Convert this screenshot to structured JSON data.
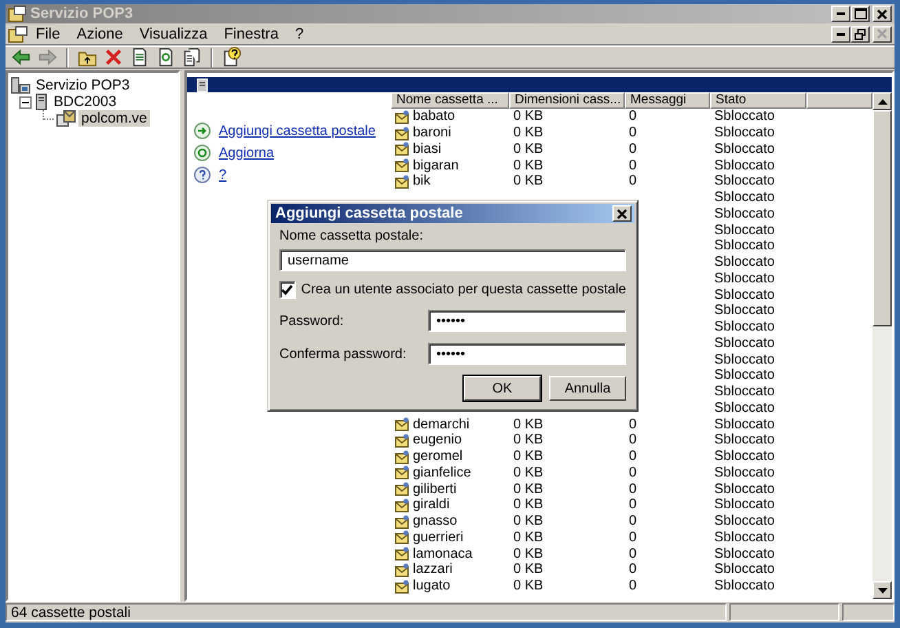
{
  "window": {
    "title": "Servizio POP3",
    "active": false
  },
  "menu": [
    "File",
    "Azione",
    "Visualizza",
    "Finestra",
    "?"
  ],
  "document_controls": {
    "close_disabled": true
  },
  "toolbar": [
    {
      "kind": "back",
      "disabled": false
    },
    {
      "kind": "forward",
      "disabled": true
    },
    {
      "kind": "separator"
    },
    {
      "kind": "up",
      "disabled": false
    },
    {
      "kind": "delete",
      "disabled": false
    },
    {
      "kind": "properties",
      "disabled": false
    },
    {
      "kind": "refresh",
      "disabled": false
    },
    {
      "kind": "export",
      "disabled": false
    },
    {
      "kind": "separator"
    },
    {
      "kind": "help",
      "disabled": false
    }
  ],
  "tree": [
    {
      "label": "Servizio POP3",
      "kind": "service",
      "selected": false,
      "children": [
        {
          "label": "BDC2003",
          "kind": "server",
          "expanded": true,
          "selected": false,
          "children": [
            {
              "label": "polcom.ve",
              "kind": "domain",
              "selected": true
            }
          ]
        }
      ]
    }
  ],
  "taskpad": [
    {
      "label": "Aggiungi cassetta postale",
      "kind": "add"
    },
    {
      "label": "Aggiorna",
      "kind": "refresh"
    },
    {
      "label": "?",
      "kind": "help"
    }
  ],
  "list": {
    "columns": [
      "Nome cassetta ...",
      "Dimensioni cass...",
      "Messaggi",
      "Stato"
    ],
    "rows": [
      {
        "name": "babato",
        "size": "0 KB",
        "messages": "0",
        "status": "Sbloccato"
      },
      {
        "name": "baroni",
        "size": "0 KB",
        "messages": "0",
        "status": "Sbloccato"
      },
      {
        "name": "biasi",
        "size": "0 KB",
        "messages": "0",
        "status": "Sbloccato"
      },
      {
        "name": "bigaran",
        "size": "0 KB",
        "messages": "0",
        "status": "Sbloccato"
      },
      {
        "name": "bik",
        "size": "0 KB",
        "messages": "0",
        "status": "Sbloccato"
      },
      {
        "status": "Sbloccato"
      },
      {
        "status": "Sbloccato"
      },
      {
        "status": "Sbloccato"
      },
      {
        "status": "Sbloccato"
      },
      {
        "status": "Sbloccato"
      },
      {
        "status": "Sbloccato"
      },
      {
        "status": "Sbloccato"
      },
      {
        "status": "Sbloccato"
      },
      {
        "status": "Sbloccato"
      },
      {
        "status": "Sbloccato"
      },
      {
        "status": "Sbloccato"
      },
      {
        "status": "Sbloccato"
      },
      {
        "status": "Sbloccato"
      },
      {
        "status": "Sbloccato"
      },
      {
        "name": "demarchi",
        "size": "0 KB",
        "messages": "0",
        "status": "Sbloccato"
      },
      {
        "name": "eugenio",
        "size": "0 KB",
        "messages": "0",
        "status": "Sbloccato"
      },
      {
        "name": "geromel",
        "size": "0 KB",
        "messages": "0",
        "status": "Sbloccato"
      },
      {
        "name": "gianfelice",
        "size": "0 KB",
        "messages": "0",
        "status": "Sbloccato"
      },
      {
        "name": "giliberti",
        "size": "0 KB",
        "messages": "0",
        "status": "Sbloccato"
      },
      {
        "name": "giraldi",
        "size": "0 KB",
        "messages": "0",
        "status": "Sbloccato"
      },
      {
        "name": "gnasso",
        "size": "0 KB",
        "messages": "0",
        "status": "Sbloccato"
      },
      {
        "name": "guerrieri",
        "size": "0 KB",
        "messages": "0",
        "status": "Sbloccato"
      },
      {
        "name": "lamonaca",
        "size": "0 KB",
        "messages": "0",
        "status": "Sbloccato"
      },
      {
        "name": "lazzari",
        "size": "0 KB",
        "messages": "0",
        "status": "Sbloccato"
      },
      {
        "name": "lugato",
        "size": "0 KB",
        "messages": "0",
        "status": "Sbloccato"
      }
    ]
  },
  "dialog": {
    "title": "Aggiungi cassetta postale",
    "active": true,
    "name_field": {
      "label": "Nome cassetta postale:",
      "value": "username"
    },
    "checkbox": {
      "label": "Crea un utente associato per questa cassette postale",
      "checked": true
    },
    "password_fields": [
      {
        "label": "Password:",
        "value": "••••••"
      },
      {
        "label": "Conferma password:",
        "value": "••••••"
      }
    ],
    "buttons": [
      {
        "label": "OK",
        "default": true
      },
      {
        "label": "Annulla",
        "default": false
      }
    ]
  },
  "status_bar": {
    "text": "64 cassette postali"
  }
}
